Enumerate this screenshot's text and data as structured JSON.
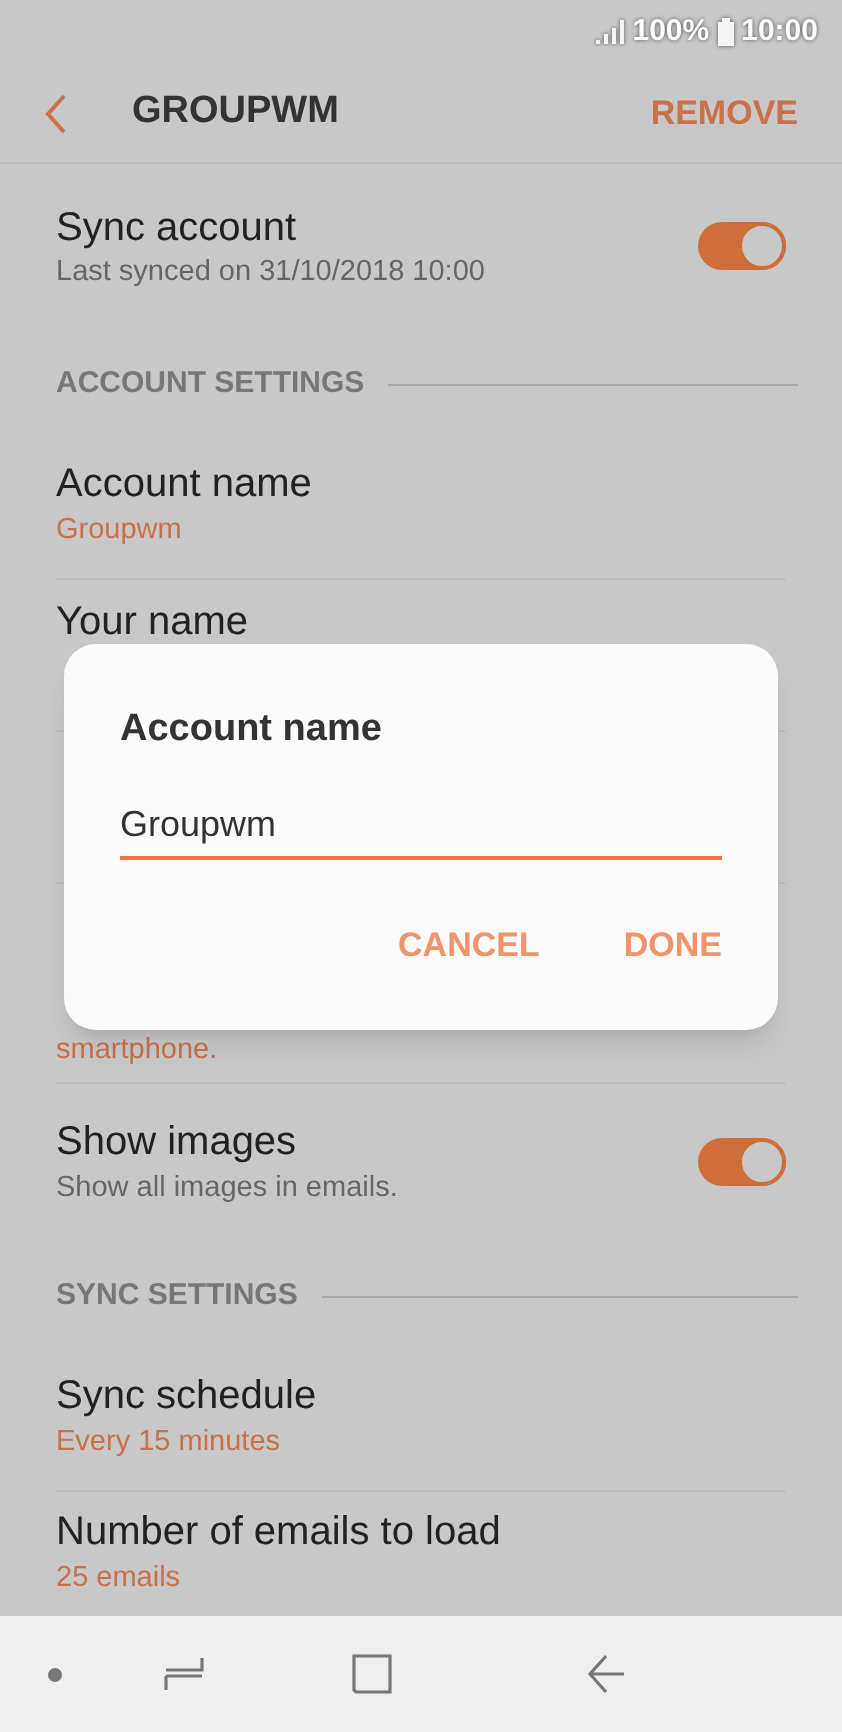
{
  "status_bar": {
    "battery": "100%",
    "time": "10:00"
  },
  "header": {
    "title": "GROUPWM",
    "action": "REMOVE"
  },
  "sync_account": {
    "title": "Sync account",
    "subtitle": "Last synced on 31/10/2018  10:00",
    "on": true
  },
  "sections": [
    {
      "heading": "ACCOUNT SETTINGS",
      "rows": [
        {
          "kind": "text",
          "title": "Account name",
          "subtitle": "Groupwm"
        },
        {
          "kind": "text",
          "title": "Your name"
        },
        {
          "kind": "text"
        },
        {
          "kind": "tall",
          "subtitle": "smartphone."
        },
        {
          "kind": "toggle",
          "title": "Show images",
          "subtitle": "Show all images in emails.",
          "on": true
        }
      ]
    },
    {
      "heading": "SYNC SETTINGS",
      "rows": [
        {
          "kind": "text",
          "title": "Sync schedule",
          "subtitle": "Every 15 minutes"
        },
        {
          "kind": "text",
          "title": "Number of emails to load",
          "subtitle": "25 emails"
        }
      ]
    }
  ],
  "dialog": {
    "title": "Account name",
    "value": "Groupwm",
    "buttons": [
      "CANCEL",
      "DONE"
    ]
  }
}
